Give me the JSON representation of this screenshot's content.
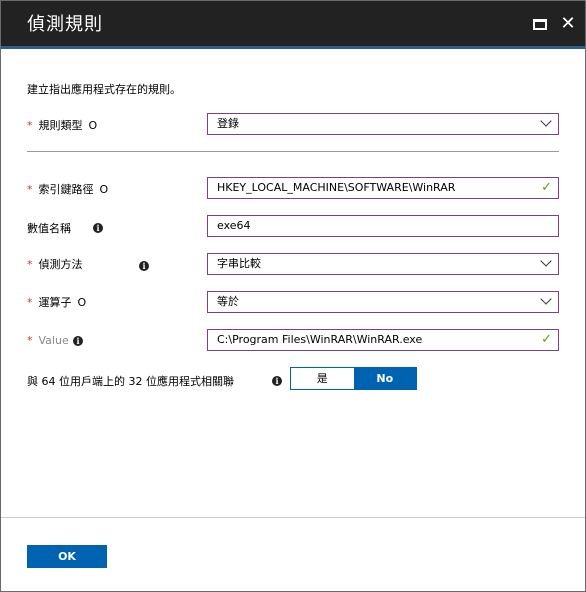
{
  "window": {
    "title": "偵測規則"
  },
  "description": "建立指出應用程式存在的規則。",
  "rule_type": {
    "required": "*",
    "label": "規則類型",
    "marker": "O",
    "value": "登錄"
  },
  "key_path": {
    "required": "*",
    "label": "索引鍵路徑",
    "marker": "O",
    "value": "HKEY_LOCAL_MACHINE\\SOFTWARE\\WinRAR",
    "valid": true
  },
  "value_name": {
    "label": "數值名稱",
    "value": "exe64"
  },
  "detection_method": {
    "required": "*",
    "label": "偵測方法",
    "value": "字串比較"
  },
  "operator": {
    "required": "*",
    "label": "運算子",
    "marker": "O",
    "value": "等於"
  },
  "value": {
    "required": "*",
    "label": "Value",
    "value": "C:\\Program Files\\WinRAR\\WinRAR.exe",
    "valid": true
  },
  "assoc_32bit": {
    "label": "與 64 位用戶端上的 32 位應用程式相關聯",
    "options": [
      "是",
      "No"
    ],
    "selected": "No"
  },
  "ok_label": "OK",
  "icons": {
    "info": "i",
    "check": "✓",
    "close": "✕"
  },
  "colors": {
    "accent": "#0063b1",
    "required": "#c43b1d",
    "field_border": "#7b3f8c",
    "valid": "#57a300",
    "titlebar": "#222222"
  }
}
